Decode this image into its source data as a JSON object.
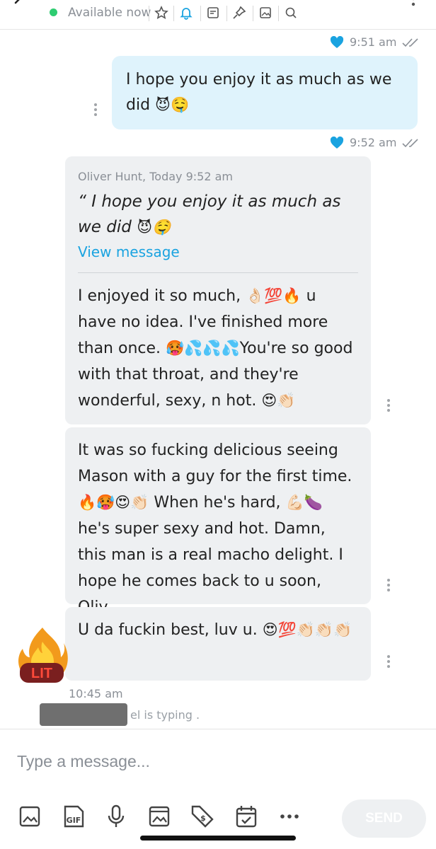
{
  "header": {
    "status_text": "Available now",
    "status_color": "#2ecc71",
    "icons": [
      "star-icon",
      "bell-icon",
      "note-icon",
      "pin-icon",
      "image-icon",
      "search-icon"
    ]
  },
  "messages": {
    "receipt_1": {
      "time": "9:51 am"
    },
    "outgoing": {
      "text": "I hope you enjoy it as much as we did",
      "emojis": "😈🤤"
    },
    "receipt_2": {
      "time": "9:52 am"
    },
    "reply": {
      "quote_meta": "Oliver Hunt, Today 9:52 am",
      "quote_text": "“ I hope you enjoy it as much as we did",
      "quote_emojis": "😈🤤",
      "view_link": "View message",
      "part1_a": "I enjoyed it so much,",
      "part1_emoji_a": "👌🏻💯🔥",
      "part1_b": "u have no idea. I've finished more than once.",
      "part1_emoji_b": "🥵💦💦💦",
      "part1_c": "You're so good with that throat, and they're wonderful, sexy, n hot.",
      "part1_emoji_c": "😍👏🏻"
    },
    "second": {
      "text_a": "It was so fucking delicious seeing Mason with a guy for the first time.",
      "emoji_a": "🔥🥵😍👏🏻",
      "text_b": "When he's hard,",
      "emoji_b": "💪🏻🍆",
      "text_c": "he's super sexy and hot. Damn, this man is a real macho delight. I hope he comes back to u soon, Oliv."
    },
    "third": {
      "text": "U da fuckin best, luv u.",
      "emojis": "😍💯👏🏻👏🏻👏🏻",
      "avatar_label": "LIT"
    },
    "time_label": "10:45 am",
    "typing_text": "el is typing ."
  },
  "composer": {
    "placeholder": "Type a message...",
    "send_label": "SEND",
    "tools": [
      "image-icon",
      "gif-icon",
      "mic-icon",
      "photo-icon",
      "tag-dollar-icon",
      "calendar-icon",
      "more-icon"
    ]
  },
  "colors": {
    "outgoing_bubble": "#dff3fc",
    "incoming_bubble": "#eef0f2",
    "link": "#1aa3e0",
    "heart": "#1aa3e0"
  }
}
